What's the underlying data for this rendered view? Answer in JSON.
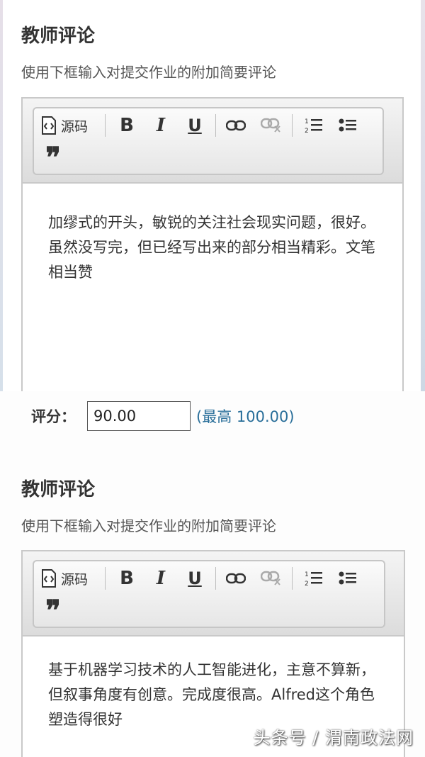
{
  "section1": {
    "heading": "教师评论",
    "subtitle": "使用下框输入对提交作业的附加简要评论",
    "toolbar": {
      "source_label": "源码",
      "bold_label": "B",
      "italic_label": "I",
      "underline_label": "U",
      "quote_label": "❞"
    },
    "content": "加缪式的开头，敏锐的关注社会现实问题，很好。虽然没写完，但已经写出来的部分相当精彩。文笔相当赞"
  },
  "grade": {
    "label": "评分：",
    "value": "90.00",
    "max_text": "(最高 100.00)"
  },
  "section2": {
    "heading": "教师评论",
    "subtitle": "使用下框输入对提交作业的附加简要评论",
    "toolbar": {
      "source_label": "源码",
      "bold_label": "B",
      "italic_label": "I",
      "underline_label": "U",
      "quote_label": "❞"
    },
    "content": "基于机器学习技术的人工智能进化，主意不算新，但叙事角度有创意。完成度很高。Alfred这个角色塑造得很好"
  },
  "watermark": "头条号 / 渭南政法网",
  "colors": {
    "link": "#2a6f9a",
    "border": "#c9c9c9"
  }
}
